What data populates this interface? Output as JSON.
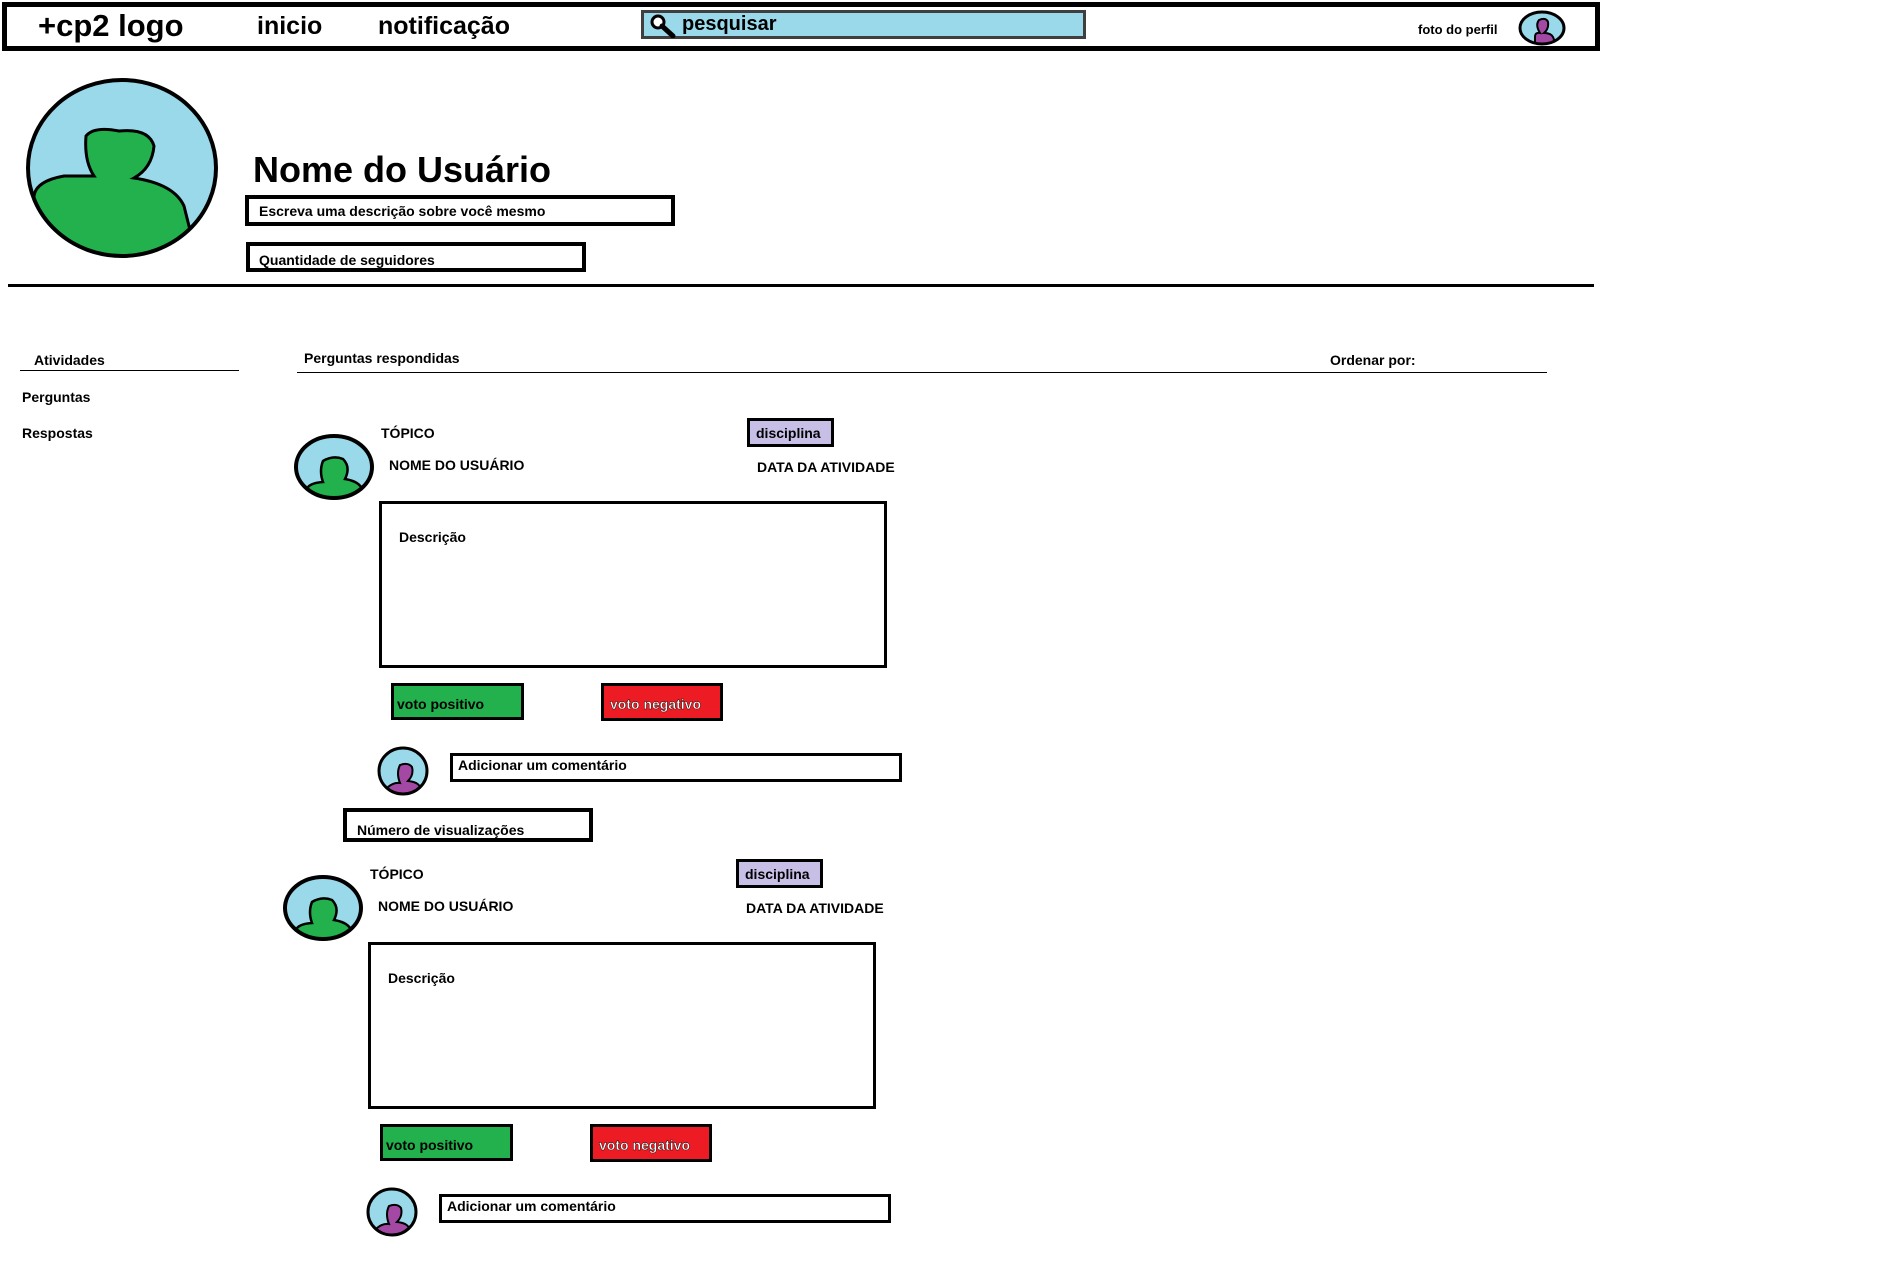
{
  "navbar": {
    "logo": "+cp2 logo",
    "home": "inicio",
    "notifications": "notificação",
    "search_placeholder": "pesquisar",
    "profile_photo_label": "foto do perfil"
  },
  "profile": {
    "name": "Nome do Usuário",
    "description_placeholder": "Escreva uma descrição sobre você mesmo",
    "followers": "Quantidade de seguidores"
  },
  "sidebar": {
    "title": "Atividades",
    "items": [
      {
        "label": "Perguntas"
      },
      {
        "label": "Respostas"
      }
    ]
  },
  "main": {
    "section_title": "Perguntas respondidas",
    "sort_label": "Ordenar por:"
  },
  "posts": [
    {
      "topic": "TÓPICO",
      "user": "NOME DO USUÁRIO",
      "discipline": "disciplina",
      "date": "DATA DA ATIVIDADE",
      "description": "Descrição",
      "upvote": "voto positivo",
      "downvote": "voto negativo",
      "comment_placeholder": "Adicionar um comentário"
    },
    {
      "topic": "TÓPICO",
      "user": "NOME DO USUÁRIO",
      "discipline": "disciplina",
      "date": "DATA DA ATIVIDADE",
      "description": "Descrição",
      "upvote": "voto positivo",
      "downvote": "voto negativo",
      "comment_placeholder": "Adicionar um comentário"
    }
  ],
  "views_label": "Número de visualizações",
  "colors": {
    "search_bg": "#99d9ea",
    "avatar_bg": "#99d9ea",
    "avatar_person": "#22b14c",
    "small_avatar_person": "#a349a4",
    "discipline_bg": "#c8bfe7",
    "upvote_bg": "#22b14c",
    "downvote_bg": "#ed1c24"
  }
}
